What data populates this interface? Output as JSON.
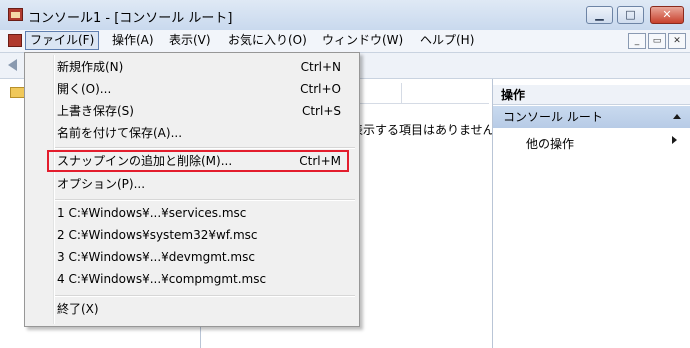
{
  "window": {
    "title": "コンソール1 - [コンソール ルート]",
    "minimize_label": "▁",
    "maximize_label": "□",
    "close_label": "✕"
  },
  "menubar": {
    "items": [
      "ファイル(F)",
      "操作(A)",
      "表示(V)",
      "お気に入り(O)",
      "ウィンドウ(W)",
      "ヘルプ(H)"
    ],
    "mdi_buttons": [
      "_",
      "▭",
      "✕"
    ]
  },
  "center": {
    "empty_message": "表示する項目はありません。"
  },
  "actions": {
    "header": "操作",
    "section_title": "コンソール ルート",
    "more_actions": "他の操作"
  },
  "file_menu": {
    "new": "新規作成(N)",
    "new_shortcut": "Ctrl+N",
    "open": "開く(O)...",
    "open_shortcut": "Ctrl+O",
    "save": "上書き保存(S)",
    "save_shortcut": "Ctrl+S",
    "save_as": "名前を付けて保存(A)...",
    "add_remove_snapin": "スナップインの追加と削除(M)...",
    "add_remove_snapin_shortcut": "Ctrl+M",
    "options": "オプション(P)...",
    "recent": [
      "1 C:¥Windows¥...¥services.msc",
      "2 C:¥Windows¥system32¥wf.msc",
      "3 C:¥Windows¥...¥devmgmt.msc",
      "4 C:¥Windows¥...¥compmgmt.msc"
    ],
    "exit": "終了(X)"
  }
}
